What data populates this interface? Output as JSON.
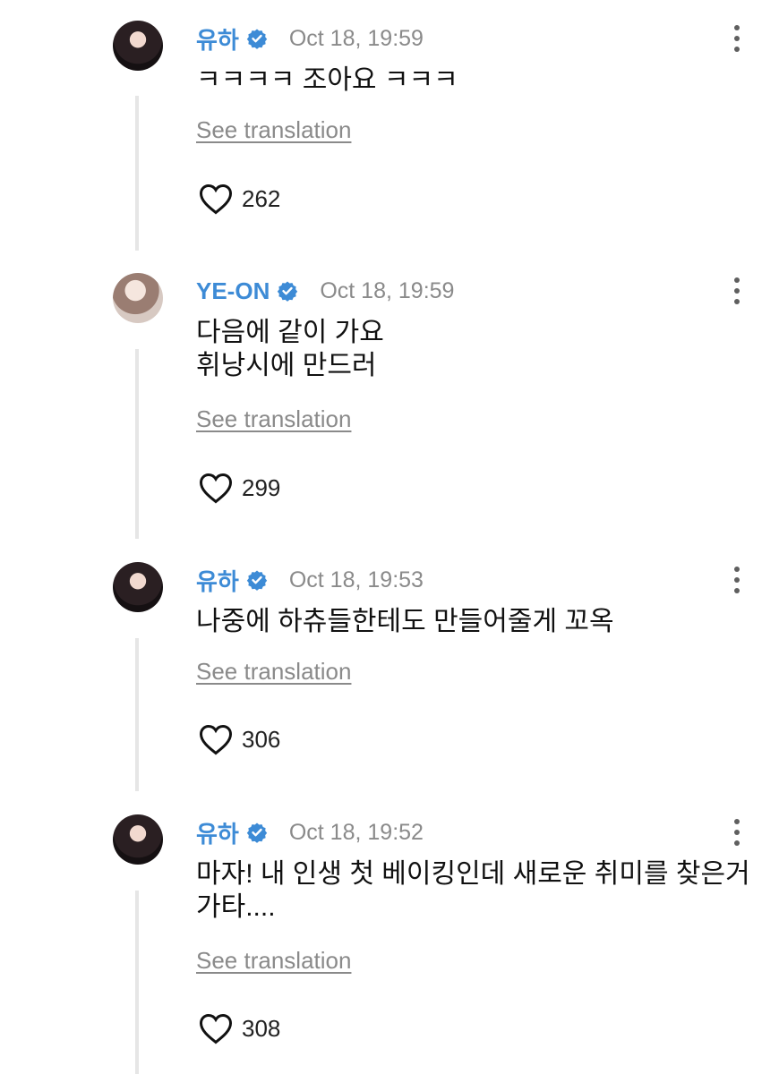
{
  "comments": [
    {
      "author": "유하",
      "avatar": "profile-photo-dark",
      "verified": "verified-badge-icon",
      "time": "Oct 18, 19:59",
      "text": "ㅋㅋㅋㅋ 조아요 ㅋㅋㅋ",
      "translate_label": "See translation",
      "likes": "262"
    },
    {
      "author": "YE-ON",
      "avatar": "profile-photo-light",
      "verified": "verified-badge-icon",
      "time": "Oct 18, 19:59",
      "text": "다음에 같이 가요\n휘낭시에 만드러",
      "translate_label": "See translation",
      "likes": "299"
    },
    {
      "author": "유하",
      "avatar": "profile-photo-dark",
      "verified": "verified-badge-icon",
      "time": "Oct 18, 19:53",
      "text": "나중에 하츄들한테도 만들어줄게 꼬옥",
      "translate_label": "See translation",
      "likes": "306"
    },
    {
      "author": "유하",
      "avatar": "profile-photo-dark",
      "verified": "verified-badge-icon",
      "time": "Oct 18, 19:52",
      "text": "마자! 내 인생 첫 베이킹인데 새로운 취미를 찾은거\n가타....",
      "translate_label": "See translation",
      "likes": "308"
    }
  ],
  "colors": {
    "author": "#3d8bd6",
    "verified": "#3d8bd6",
    "muted": "#8a8a8a",
    "thread_line": "#e6e6e6"
  }
}
